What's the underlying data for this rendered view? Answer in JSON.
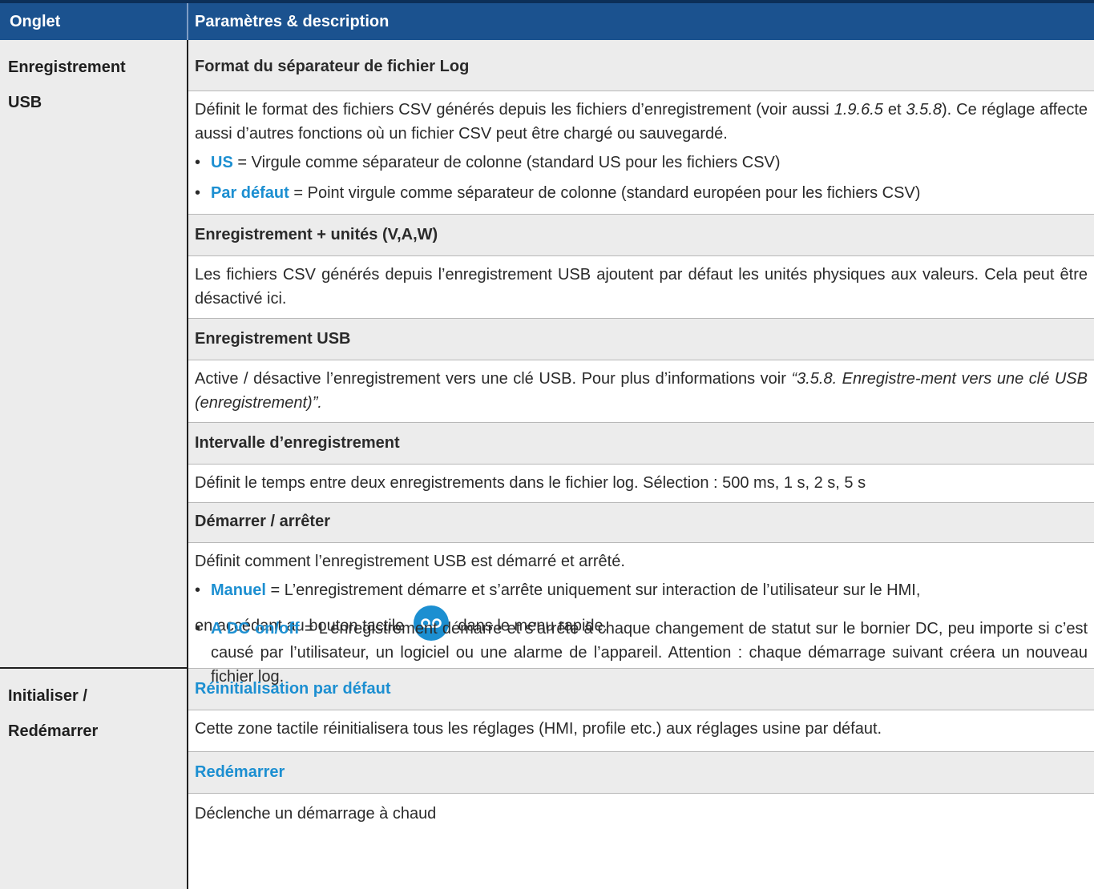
{
  "header": {
    "col1": "Onglet",
    "col2": "Paramètres & description"
  },
  "sections": [
    {
      "tab": "Enregistrement USB",
      "items": [
        {
          "title": "Format du séparateur de fichier Log",
          "desc_pre": "Définit le format des fichiers CSV générés depuis les fichiers d’enregistrement (voir aussi ",
          "ref1": "1.9.6.5",
          "desc_mid": " et ",
          "ref2": "3.5.8",
          "desc_post": "). Ce réglage affecte aussi d’autres fonctions où un fichier CSV peut être chargé ou sauvegardé.",
          "bullets": [
            {
              "key": "US",
              "text": " = Virgule comme séparateur de colonne (standard US pour les fichiers CSV)"
            },
            {
              "key": "Par défaut",
              "text": " = Point virgule comme séparateur de colonne (standard européen pour les fichiers CSV)"
            }
          ]
        },
        {
          "title": "Enregistrement + unités (V,A,W)",
          "desc": "Les fichiers CSV générés depuis l’enregistrement USB ajoutent par défaut les unités physiques aux valeurs. Cela peut être désactivé ici."
        },
        {
          "title": "Enregistrement USB",
          "desc_pre": "Active / désactive l’enregistrement vers une clé USB. Pour plus d’informations voir ",
          "desc_ref": "“3.5.8. Enregistre-ment vers une clé USB (enregistrement)”."
        },
        {
          "title": "Intervalle d’enregistrement",
          "desc": "Définit le temps entre deux enregistrements dans le fichier log. Sélection : 500 ms, 1 s, 2 s, 5 s"
        },
        {
          "title": "Démarrer / arrêter",
          "desc": "Définit comment l’enregistrement USB est démarré et arrêté.",
          "bullets": [
            {
              "key": "Manuel",
              "text": " = L’enregistrement démarre et s’arrête uniquement sur interaction de l’utilisateur sur le HMI,",
              "line2_pre": "en accédant au bouton tactile",
              "line2_post": "dans le menu rapide.",
              "icon": "record-icon"
            },
            {
              "key": "A DC on/off",
              "text": " = L’enregistrement démarre et s’arrête à chaque changement de statut sur le bornier DC, peu importe si c’est causé par l’utilisateur, un logiciel ou une alarme de l’appareil. Attention : chaque démarrage suivant créera un nouveau fichier log."
            }
          ]
        }
      ]
    },
    {
      "tab": "Initialiser / Redémarrer",
      "items": [
        {
          "title": "Réinitialisation par défaut",
          "desc": "Cette zone tactile réinitialisera tous les réglages (HMI, profile etc.) aux réglages usine par défaut."
        },
        {
          "title": "Redémarrer",
          "desc": "Déclenche un démarrage à chaud"
        }
      ]
    }
  ],
  "colors": {
    "header_bg": "#1b528f",
    "accent_blue": "#1c8fd1",
    "title_row_bg": "#ececec"
  }
}
